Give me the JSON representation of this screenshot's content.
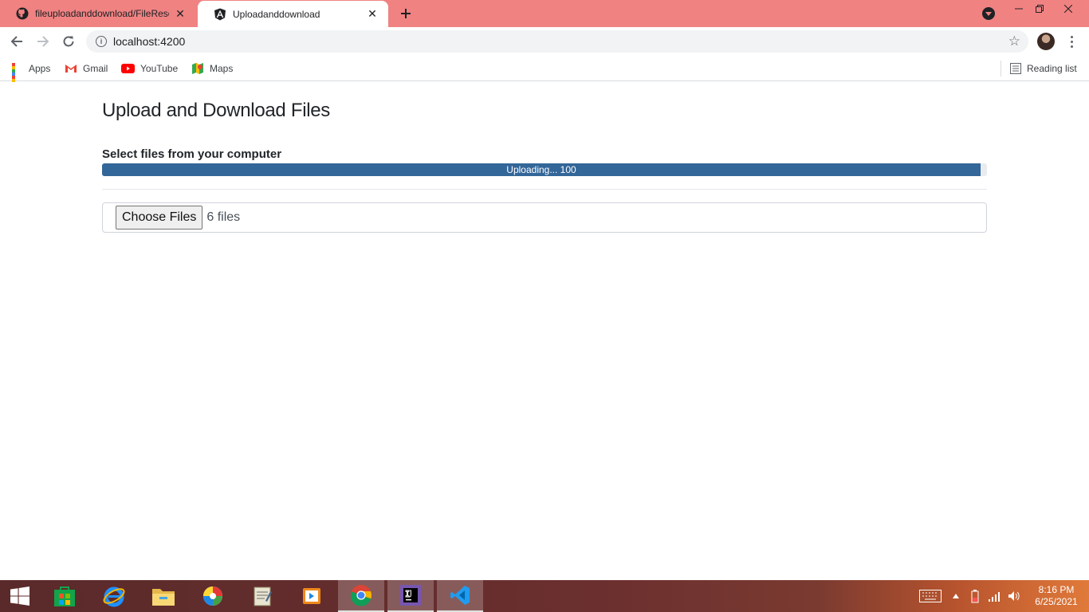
{
  "browser": {
    "tabs": [
      {
        "title": "fileuploadanddownload/FileResource",
        "active": false,
        "favicon": "github-icon"
      },
      {
        "title": "Uploadanddownload",
        "active": true,
        "favicon": "angular-icon"
      }
    ],
    "address": {
      "url": "localhost:4200"
    },
    "bookmarks": [
      {
        "label": "Apps",
        "icon": "apps-grid-icon"
      },
      {
        "label": "Gmail",
        "icon": "gmail-icon"
      },
      {
        "label": "YouTube",
        "icon": "youtube-icon"
      },
      {
        "label": "Maps",
        "icon": "maps-icon"
      }
    ],
    "reading_list": "Reading list",
    "theme_color": "#f08282"
  },
  "page": {
    "title": "Upload and Download Files",
    "select_label": "Select files from your computer",
    "progress": {
      "text": "Uploading... 100",
      "percent": 100,
      "color": "#336699"
    },
    "file_input": {
      "button_label": "Choose Files",
      "status": "6 files"
    }
  },
  "taskbar": {
    "apps": [
      "start-icon",
      "store-icon",
      "internet-explorer-icon",
      "file-explorer-icon",
      "photos-icon",
      "notepad-icon",
      "media-player-icon",
      "chrome-icon",
      "intellij-icon",
      "vscode-icon"
    ],
    "clock": {
      "time": "8:16 PM",
      "date": "6/25/2021"
    }
  }
}
